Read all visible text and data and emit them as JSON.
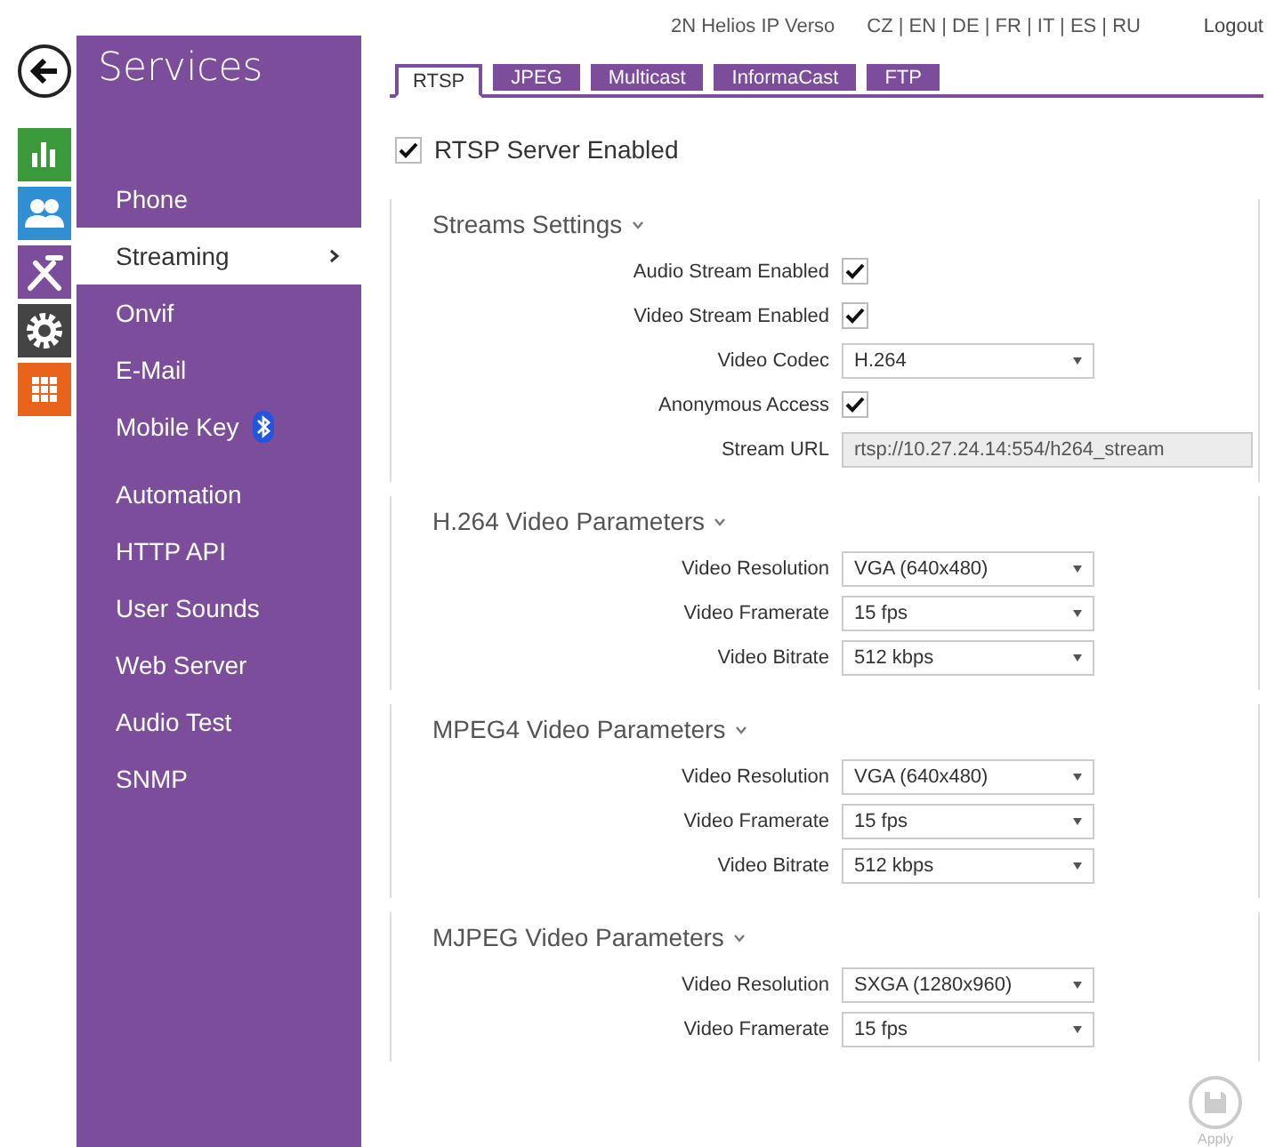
{
  "header": {
    "device": "2N Helios IP Verso",
    "languages": "CZ | EN | DE | FR | IT | ES | RU",
    "logout": "Logout"
  },
  "sidebar": {
    "title": "Services",
    "groups": [
      {
        "items": [
          {
            "label": "Phone",
            "selected": false,
            "kind": "plain"
          },
          {
            "label": "Streaming",
            "selected": true,
            "kind": "plain"
          },
          {
            "label": "Onvif",
            "selected": false,
            "kind": "plain"
          },
          {
            "label": "E-Mail",
            "selected": false,
            "kind": "plain"
          },
          {
            "label": "Mobile Key",
            "selected": false,
            "kind": "bluetooth"
          }
        ]
      },
      {
        "items": [
          {
            "label": "Automation",
            "selected": false,
            "kind": "plain"
          },
          {
            "label": "HTTP API",
            "selected": false,
            "kind": "plain"
          },
          {
            "label": "User Sounds",
            "selected": false,
            "kind": "plain"
          },
          {
            "label": "Web Server",
            "selected": false,
            "kind": "plain"
          },
          {
            "label": "Audio Test",
            "selected": false,
            "kind": "plain"
          },
          {
            "label": "SNMP",
            "selected": false,
            "kind": "plain"
          }
        ]
      }
    ]
  },
  "tabs": [
    {
      "label": "RTSP",
      "selected": true
    },
    {
      "label": "JPEG",
      "selected": false
    },
    {
      "label": "Multicast",
      "selected": false
    },
    {
      "label": "InformaCast",
      "selected": false
    },
    {
      "label": "FTP",
      "selected": false
    }
  ],
  "server_enabled": {
    "label": "RTSP Server Enabled",
    "checked": true
  },
  "sections": [
    {
      "title": "Streams Settings",
      "expanded": true,
      "fields": [
        {
          "kind": "checkbox",
          "label": "Audio Stream Enabled",
          "checked": true
        },
        {
          "kind": "checkbox",
          "label": "Video Stream Enabled",
          "checked": true
        },
        {
          "kind": "select",
          "label": "Video Codec",
          "value": "H.264"
        },
        {
          "kind": "checkbox",
          "label": "Anonymous Access",
          "checked": true
        },
        {
          "kind": "text",
          "label": "Stream URL",
          "value": "rtsp://10.27.24.14:554/h264_stream",
          "disabled": true
        }
      ]
    },
    {
      "title": "H.264 Video Parameters",
      "expanded": true,
      "fields": [
        {
          "kind": "select",
          "label": "Video Resolution",
          "value": "VGA (640x480)"
        },
        {
          "kind": "select",
          "label": "Video Framerate",
          "value": "15 fps"
        },
        {
          "kind": "select",
          "label": "Video Bitrate",
          "value": "512 kbps"
        }
      ]
    },
    {
      "title": "MPEG4 Video Parameters",
      "expanded": true,
      "fields": [
        {
          "kind": "select",
          "label": "Video Resolution",
          "value": "VGA (640x480)"
        },
        {
          "kind": "select",
          "label": "Video Framerate",
          "value": "15 fps"
        },
        {
          "kind": "select",
          "label": "Video Bitrate",
          "value": "512 kbps"
        }
      ]
    },
    {
      "title": "MJPEG Video Parameters",
      "expanded": true,
      "fields": [
        {
          "kind": "select",
          "label": "Video Resolution",
          "value": "SXGA (1280x960)"
        },
        {
          "kind": "select",
          "label": "Video Framerate",
          "value": "15 fps"
        }
      ]
    }
  ],
  "apply": {
    "label": "Apply",
    "disabled": true
  }
}
